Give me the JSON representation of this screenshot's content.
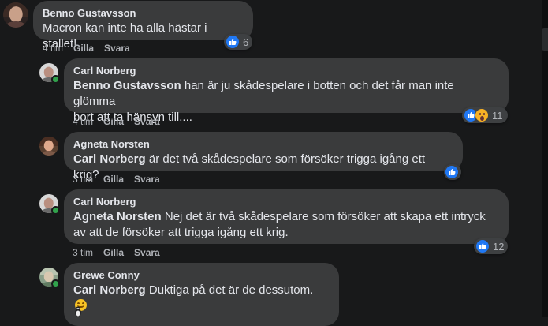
{
  "comments": [
    {
      "author": "Benno Gustavsson",
      "mention": "",
      "text": "Macron kan inte ha alla hästar i stallet!",
      "time": "4 tim",
      "like_label": "Gilla",
      "reply_label": "Svara",
      "reactions": {
        "icons": [
          "like-icon"
        ],
        "count": "6"
      }
    },
    {
      "author": "Carl Norberg",
      "mention": "Benno Gustavsson",
      "text_line1": " han är ju skådespelare i botten och det får man inte glömma",
      "text_line2": "bort att ta hänsyn till....",
      "time": "4 tim",
      "like_label": "Gilla",
      "reply_label": "Svara",
      "reactions": {
        "icons": [
          "like-icon",
          "wow-icon"
        ],
        "count": "11"
      }
    },
    {
      "author": "Agneta Norsten",
      "mention": "Carl Norberg",
      "text": " är det två skådespelare som försöker trigga igång ett krig?",
      "time": "3 tim",
      "like_label": "Gilla",
      "reply_label": "Svara",
      "reactions": {
        "icons": [
          "like-icon"
        ],
        "count": ""
      }
    },
    {
      "author": "Carl Norberg",
      "mention": "Agneta Norsten",
      "text_line1": " Nej det är två skådespelare som försöker att skapa ett intryck",
      "text_line2": "av att de försöker att trigga igång ett krig.",
      "time": "3 tim",
      "like_label": "Gilla",
      "reply_label": "Svara",
      "reactions": {
        "icons": [
          "like-icon"
        ],
        "count": "12"
      }
    },
    {
      "author": "Grewe Conny",
      "mention": "Carl Norberg",
      "text": " Duktiga på det är de dessutom.",
      "emoji": "smiling-face-icon"
    }
  ],
  "colors": {
    "background": "#18191a",
    "bubble": "#3a3b3c",
    "like_blue": "#2078f4",
    "online_green": "#31a24c"
  }
}
